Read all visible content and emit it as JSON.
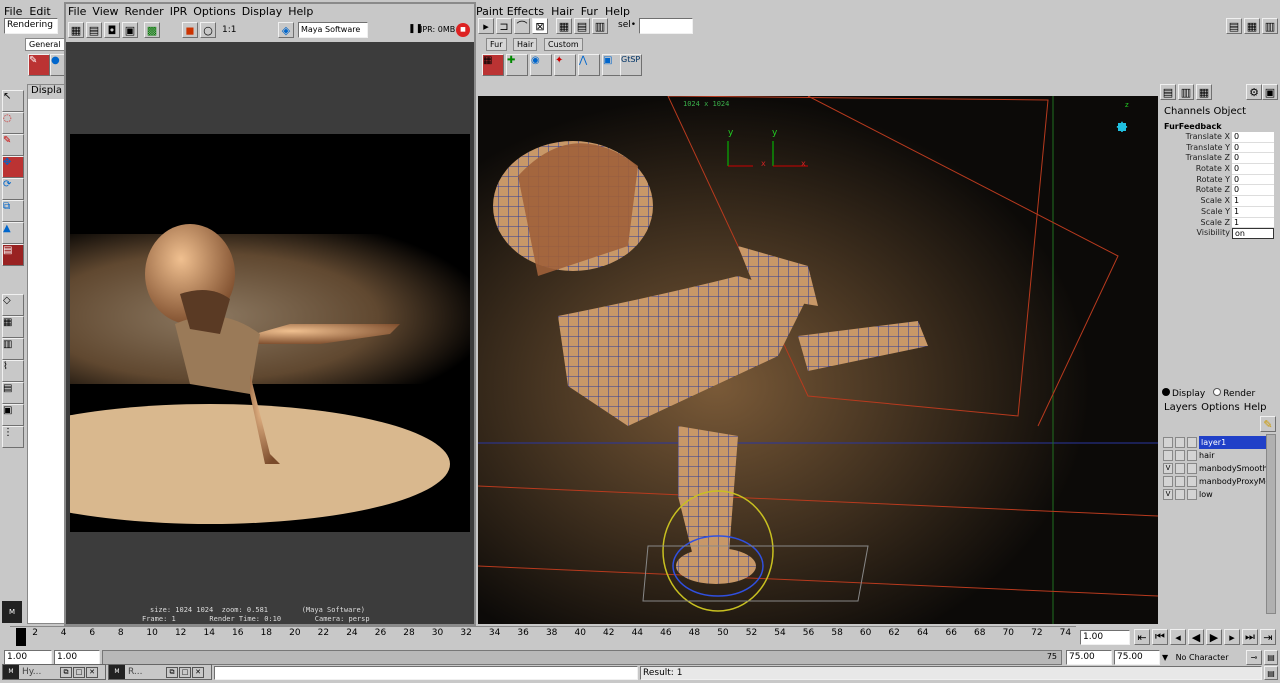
{
  "main_menu": {
    "items": [
      "File",
      "Edit"
    ],
    "right_items": [
      "Paint Effects",
      "Hair",
      "Fur",
      "Help"
    ]
  },
  "mode_dropdown": "Rendering",
  "shelf_tabs": [
    "General",
    "Fur",
    "Hair",
    "Custom"
  ],
  "sel_label": "sel•",
  "outliner_label": "Displa",
  "render_view": {
    "menu": [
      "File",
      "View",
      "Render",
      "IPR",
      "Options",
      "Display",
      "Help"
    ],
    "ratio_label": "1:1",
    "renderer": "Maya Software",
    "ipr_label": "IPR: 0MB",
    "info_line1": "size: 1024 1024  zoom: 0.581        (Maya Software)",
    "info_line2": "Frame: 1        Render Time: 0:10        Camera: persp"
  },
  "viewport": {
    "resolution_label": "1024 x 1024",
    "axis_y": "y",
    "axis_x": "x",
    "axis_z": "z"
  },
  "channel_box": {
    "tabs": [
      "Channels",
      "Object"
    ],
    "object_name": "FurFeedback",
    "rows": [
      {
        "label": "Translate X",
        "value": "0"
      },
      {
        "label": "Translate Y",
        "value": "0"
      },
      {
        "label": "Translate Z",
        "value": "0"
      },
      {
        "label": "Rotate X",
        "value": "0"
      },
      {
        "label": "Rotate Y",
        "value": "0"
      },
      {
        "label": "Rotate Z",
        "value": "0"
      },
      {
        "label": "Scale X",
        "value": "1"
      },
      {
        "label": "Scale Y",
        "value": "1"
      },
      {
        "label": "Scale Z",
        "value": "1"
      },
      {
        "label": "Visibility",
        "value": "on"
      }
    ]
  },
  "layer_editor": {
    "display_radio": "Display",
    "render_radio": "Render",
    "menu": [
      "Layers",
      "Options",
      "Help"
    ],
    "layers": [
      {
        "name": "layer1",
        "visible": "",
        "selected": true
      },
      {
        "name": "hair",
        "visible": "",
        "selected": false
      },
      {
        "name": "manbodySmoothM",
        "visible": "V",
        "selected": false
      },
      {
        "name": "manbodyProxyMes",
        "visible": "",
        "selected": false
      },
      {
        "name": "low",
        "visible": "V",
        "selected": false
      }
    ]
  },
  "time_slider": {
    "ticks": [
      "1",
      "2",
      "4",
      "6",
      "8",
      "10",
      "12",
      "14",
      "16",
      "18",
      "20",
      "22",
      "24",
      "26",
      "28",
      "30",
      "32",
      "34",
      "36",
      "38",
      "40",
      "42",
      "44",
      "46",
      "48",
      "50",
      "52",
      "54",
      "56",
      "58",
      "60",
      "62",
      "64",
      "66",
      "68",
      "70",
      "72",
      "74"
    ],
    "current_frame": "1.00"
  },
  "range_slider": {
    "start": "1.00",
    "start_inner": "1.00",
    "end_marker": "75",
    "end_inner": "75.00",
    "end": "75.00",
    "char_set": "No Character Set"
  },
  "taskbar": {
    "item1": "Hy...",
    "item2": "R..."
  },
  "result_line": "Result: 1",
  "colors": {
    "panel": "#c8c8c8",
    "render_bg": "#3c3c3c",
    "viewport_bg": "#0c0a08",
    "selected_layer": "#2040c8"
  }
}
